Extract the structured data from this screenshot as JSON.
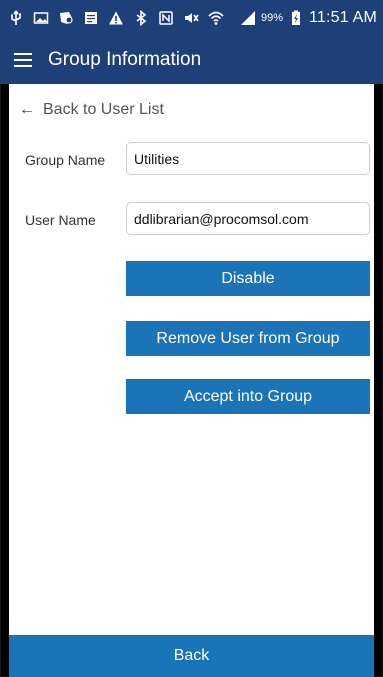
{
  "status_bar": {
    "battery_percent": "99%",
    "time": "11:51 AM",
    "icons": [
      "usb-icon",
      "image-icon",
      "app-icon",
      "notes-icon",
      "warning-icon",
      "bluetooth-icon",
      "nfc-icon",
      "mute-icon",
      "wifi-icon",
      "signal-icon",
      "battery-charging-icon"
    ]
  },
  "app_bar": {
    "title": "Group Information",
    "menu_icon": "hamburger-menu-icon"
  },
  "back_link": {
    "label": "Back to User List"
  },
  "form": {
    "group_name_label": "Group Name",
    "group_name_value": "Utilities",
    "user_name_label": "User Name",
    "user_name_value": "ddlibrarian@procomsol.com"
  },
  "actions": {
    "disable_label": "Disable",
    "remove_label": "Remove User from Group",
    "accept_label": "Accept into Group"
  },
  "bottom_bar": {
    "back_label": "Back"
  },
  "colors": {
    "header": "#1f3f78",
    "button": "#1b74b8"
  }
}
